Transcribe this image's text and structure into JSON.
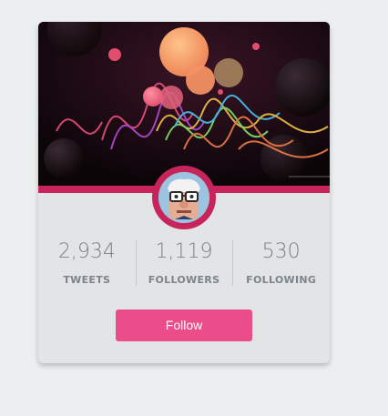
{
  "profile": {
    "stats": [
      {
        "value": "2,934",
        "label": "TWEETS"
      },
      {
        "value": "1,119",
        "label": "FOLLOWERS"
      },
      {
        "value": "530",
        "label": "FOLLOWING"
      }
    ],
    "follow_label": "Follow"
  },
  "colors": {
    "accent": "#c8245c",
    "button": "#ea4d8a",
    "card_bg": "#e2e4e5",
    "stat_text": "#7a8187"
  },
  "icons": {
    "avatar": "cartoon-old-man-avatar"
  }
}
